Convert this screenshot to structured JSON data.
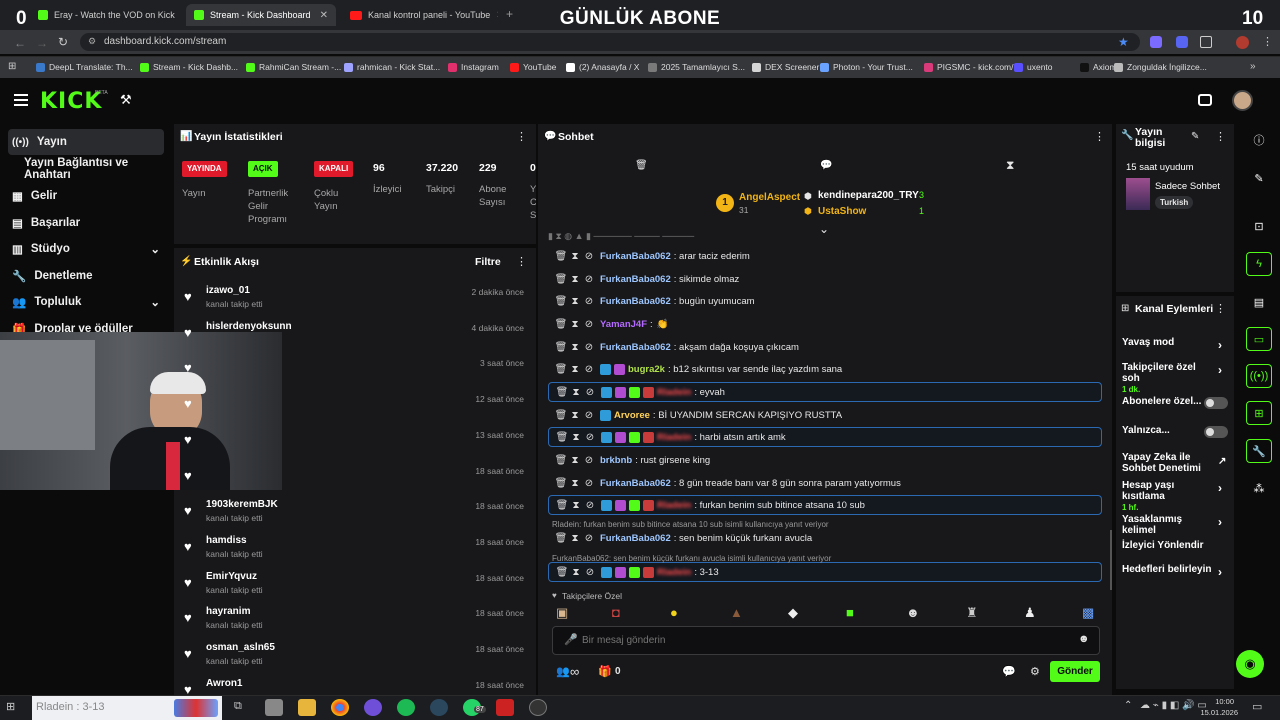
{
  "overlay": {
    "title": "GÜNLÜK ABONE",
    "left_count": "0",
    "right_count": "10"
  },
  "tabs": [
    {
      "label": "Eray - Watch the VOD on Kick"
    },
    {
      "label": "Stream - Kick Dashboard"
    },
    {
      "label": "Kanal kontrol paneli - YouTube"
    }
  ],
  "url": "dashboard.kick.com/stream",
  "bookmarks": [
    "DeepL Translate: Th...",
    "Stream - Kick Dashb...",
    "RahmiCan Stream -...",
    "rahmican - Kick Stat...",
    "Instagram",
    "YouTube",
    "(2) Anasayfa / X",
    "2025 Tamamlayıcı S...",
    "DEX Screener",
    "Photon - Your Trust...",
    "PIGSMC - kick.com/...",
    "uxento",
    "Axiom",
    "Zonguldak İngilizce..."
  ],
  "brand": {
    "logo": "KICK",
    "beta": "BETA",
    "accent": "#53fc18"
  },
  "sidebar": {
    "items": [
      {
        "label": "Yayın"
      },
      {
        "label": "Yayın Bağlantısı ve Anahtarı"
      },
      {
        "label": "Gelir"
      },
      {
        "label": "Başarılar"
      },
      {
        "label": "Stüdyo"
      },
      {
        "label": "Denetleme"
      },
      {
        "label": "Topluluk"
      },
      {
        "label": "Droplar ve ödüller"
      }
    ]
  },
  "stats": {
    "title": "Yayın İstatistikleri",
    "badges": [
      {
        "label": "YAYINDA",
        "caption": "Yayın"
      },
      {
        "label": "AÇIK",
        "caption": "Partnerlik Gelir Programı"
      },
      {
        "label": "KAPALI",
        "caption": "Çoklu Yayın"
      }
    ],
    "numbers": [
      {
        "value": "96",
        "caption": "İzleyici"
      },
      {
        "value": "37.220",
        "caption": "Takipçi"
      },
      {
        "value": "229",
        "caption": "Abone Sayısı"
      },
      {
        "value": "0",
        "caption": "Y C S"
      }
    ]
  },
  "activity": {
    "title": "Etkinlik Akışı",
    "filter": "Filtre",
    "items": [
      {
        "name": "izawo_01",
        "sub": "kanalı takip etti",
        "time": "2 dakika önce"
      },
      {
        "name": "hislerdenyoksunn",
        "sub": "",
        "time": "4 dakika önce"
      },
      {
        "name": "",
        "sub": "",
        "time": "3 saat önce"
      },
      {
        "name": "",
        "sub": "",
        "time": "12 saat önce"
      },
      {
        "name": "",
        "sub": "",
        "time": "13 saat önce"
      },
      {
        "name": "",
        "sub": "",
        "time": "18 saat önce"
      },
      {
        "name": "1903keremBJK",
        "sub": "kanalı takip etti",
        "time": "18 saat önce"
      },
      {
        "name": "hamdiss",
        "sub": "kanalı takip etti",
        "time": "18 saat önce"
      },
      {
        "name": "EmirYqvuz",
        "sub": "kanalı takip etti",
        "time": "18 saat önce"
      },
      {
        "name": "hayranim",
        "sub": "kanalı takip etti",
        "time": "18 saat önce"
      },
      {
        "name": "osman_asln65",
        "sub": "kanalı takip etti",
        "time": "18 saat önce"
      },
      {
        "name": "Awron1",
        "sub": "",
        "time": "18 saat önce"
      }
    ]
  },
  "chat": {
    "title": "Sohbet",
    "leaders": [
      {
        "name": "AngelAspect",
        "count": "31",
        "rank": "1"
      },
      {
        "name": "kendinepara200_TRY",
        "count": "3"
      },
      {
        "name": "UstaShow",
        "count": "1"
      }
    ],
    "messages": [
      {
        "user": "FurkanBaba062",
        "text": ": arar taciz ederim",
        "color": "#9ec7ff",
        "hl": false,
        "badges": 0
      },
      {
        "user": "FurkanBaba062",
        "text": ": sikimde olmaz",
        "color": "#9ec7ff",
        "hl": false,
        "badges": 0
      },
      {
        "user": "FurkanBaba062",
        "text": ": bugün uyumucam",
        "color": "#9ec7ff",
        "hl": false,
        "badges": 0
      },
      {
        "user": "YamanJ4F",
        "text": ":",
        "color": "#b46bff",
        "hl": false,
        "badges": 0
      },
      {
        "user": "FurkanBaba062",
        "text": ": akşam dağa koşuya çıkıcam",
        "color": "#9ec7ff",
        "hl": false,
        "badges": 0
      },
      {
        "user": "bugra2k",
        "text": ": b12 sıkıntısı var sende ilaç yazdım sana",
        "color": "#b0e04a",
        "hl": false,
        "badges": 2
      },
      {
        "user": "Rladein",
        "text": ": eyvah",
        "color": "#ff4b4b",
        "hl": true,
        "badges": 4
      },
      {
        "user": "Arvoree",
        "text": ": Bİ UYANDIM SERCAN KAPIŞIYO RUSTTA",
        "color": "#ffd25a",
        "hl": false,
        "badges": 1
      },
      {
        "user": "Rladein",
        "text": ": harbi atsın artık amk",
        "color": "#ff4b4b",
        "hl": true,
        "badges": 4
      },
      {
        "user": "brkbnb",
        "text": ": rust girsene king",
        "color": "#9ec7ff",
        "hl": false,
        "badges": 0
      },
      {
        "user": "FurkanBaba062",
        "text": ": 8 gün treade banı var 8 gün sonra param yatıyormus",
        "color": "#9ec7ff",
        "hl": false,
        "badges": 0
      },
      {
        "user": "Rladein",
        "text": ": furkan benim sub bitince atsana 10 sub",
        "color": "#ff4b4b",
        "hl": true,
        "badges": 4
      },
      {
        "user": "FurkanBaba062",
        "text": ": sen benim küçük furkanı avucla",
        "color": "#9ec7ff",
        "hl": false,
        "badges": 0
      },
      {
        "user": "Rladein",
        "text": ": 3-13",
        "color": "#ff4b4b",
        "hl": true,
        "badges": 4
      }
    ],
    "replies": [
      "Rladein: furkan benim sub bitince atsana 10 sub isimli kullanıcıya yanıt veriyor",
      "FurkanBaba062: sen benim küçük furkanı avucla isimli kullanıcıya yanıt veriyor"
    ],
    "followers_only": "Takipçilere Özel",
    "placeholder": "Bir mesaj gönderin",
    "send": "Gönder",
    "viewers_inf": "∞",
    "gift_count": "0"
  },
  "stream_info": {
    "title_line1": "Yayın",
    "title_line2": "bilgisi",
    "stream_title": "15 saat uyudum",
    "category": "Sadece Sohbet",
    "tag": "Turkish"
  },
  "channel_actions": {
    "title": "Kanal Eylemleri",
    "items": [
      {
        "label": "Yavaş mod",
        "sub": "",
        "kind": "chev"
      },
      {
        "label": "Takipçilere özel soh",
        "sub": "1 dk.",
        "kind": "chev"
      },
      {
        "label": "Abonelere özel...",
        "sub": "",
        "kind": "toggle"
      },
      {
        "label": "Yalnızca...",
        "sub": "",
        "kind": "toggle"
      },
      {
        "label": "Yapay Zeka ile Sohbet Denetimi",
        "sub": "",
        "kind": "ext"
      },
      {
        "label": "Hesap yaşı kısıtlama",
        "sub": "1 hf.",
        "kind": "chev"
      },
      {
        "label": "Yasaklanmış kelimel",
        "sub": "",
        "kind": "chev"
      },
      {
        "label": "İzleyici Yönlendir",
        "sub": "",
        "kind": "none"
      },
      {
        "label": "Hedefleri belirleyin",
        "sub": "",
        "kind": "chev"
      }
    ]
  },
  "taskbar": {
    "notif": "Rladein : 3-13",
    "time": "10:00",
    "date": "15.01.2026",
    "whatsapp_badge": "87"
  }
}
